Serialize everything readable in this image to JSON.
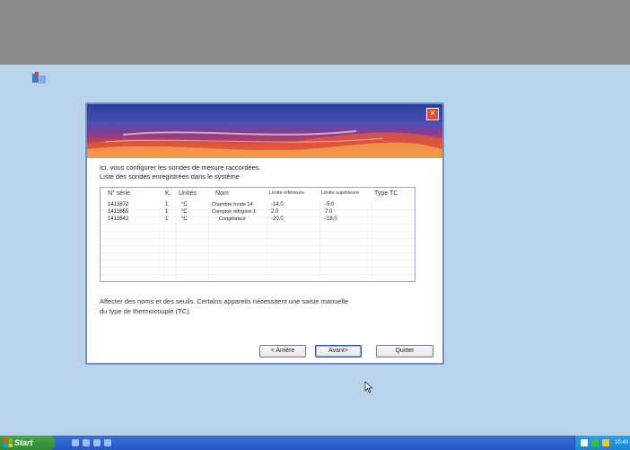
{
  "wizard": {
    "close_label": "×",
    "intro_line1": "Ici, vous configurer les sondes de mesure raccordées.",
    "intro_line2": "Liste des sondes enregistrées dans le système",
    "columns": [
      "N° série",
      "K.",
      "Unités",
      "Nom",
      "Limite inférieure",
      "Limite supérieure",
      "Type TC"
    ],
    "rows": [
      {
        "serial": "1413872",
        "k": "1",
        "unit": "°C",
        "name": "Chambre froide 14",
        "low": "-14.0",
        "high": "-5.0",
        "tc": ""
      },
      {
        "serial": "1413855",
        "k": "1",
        "unit": "°C",
        "name": "Comptoir réfrigéré 1",
        "low": "2.0",
        "high": "7.0",
        "tc": ""
      },
      {
        "serial": "1413842",
        "k": "1",
        "unit": "°C",
        "name": "Congélateur",
        "low": "-20.0",
        "high": "-18.0",
        "tc": ""
      }
    ],
    "note_line1": "Affecter des noms et des seuils. Certains appareils nécessitent une saisie manuelle",
    "note_line2": "du type de thermocouple (TC).",
    "back_label": "< Arrière",
    "next_label": "Avant>",
    "quit_label": "Quitter"
  },
  "taskbar": {
    "start_label": "Start",
    "clock": "10:40"
  },
  "icons": {
    "desktop": "desktop-app-icon",
    "close": "close-icon",
    "cursor": "mouse-cursor-icon",
    "start_logo": "windows-logo-icon"
  },
  "colors": {
    "desktop": "#b9d3e9",
    "top_band": "#8c8c8c",
    "taskbar": "#2557c7",
    "start": "#2f8a2f",
    "close": "#d9503a"
  }
}
